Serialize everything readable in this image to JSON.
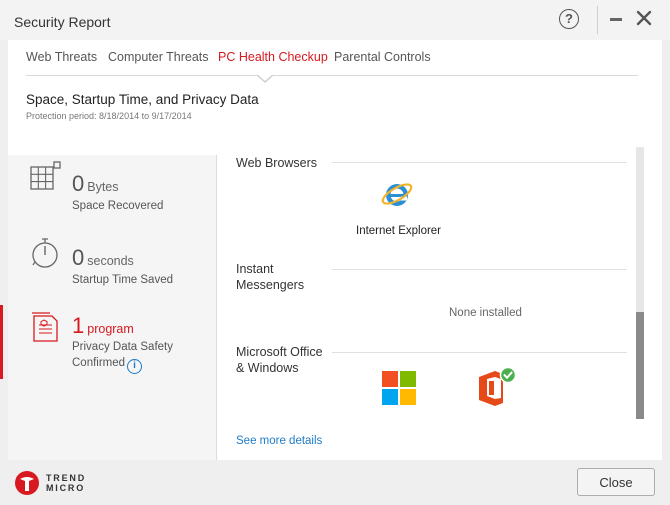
{
  "window": {
    "title": "Security Report"
  },
  "tabs": [
    {
      "label": "Web Threats"
    },
    {
      "label": "Computer Threats"
    },
    {
      "label": "PC Health Checkup"
    },
    {
      "label": "Parental Controls"
    }
  ],
  "active_tab": "PC Health Checkup",
  "section": {
    "title": "Space, Startup Time, and Privacy Data",
    "subtitle": "Protection period: 8/18/2014 to 9/17/2014"
  },
  "stats": [
    {
      "value": "0",
      "unit": "Bytes",
      "label": "Space Recovered"
    },
    {
      "value": "0",
      "unit": "seconds",
      "label": "Startup Time Saved"
    },
    {
      "value": "1",
      "unit": "program",
      "label_line1": "Privacy Data Safety",
      "label_line2": "Confirmed"
    }
  ],
  "categories": {
    "browsers": {
      "title": "Web Browsers",
      "apps": [
        "Internet Explorer"
      ]
    },
    "messengers": {
      "title_line1": "Instant",
      "title_line2": "Messengers",
      "empty_text": "None installed"
    },
    "office": {
      "title_line1": "Microsoft Office",
      "title_line2": "& Windows"
    }
  },
  "see_more": "See more details",
  "footer": {
    "logo_line1": "TREND",
    "logo_line2": "MICRO",
    "close_label": "Close"
  },
  "colors": {
    "accent": "#d71920",
    "link": "#1e7bc8"
  }
}
